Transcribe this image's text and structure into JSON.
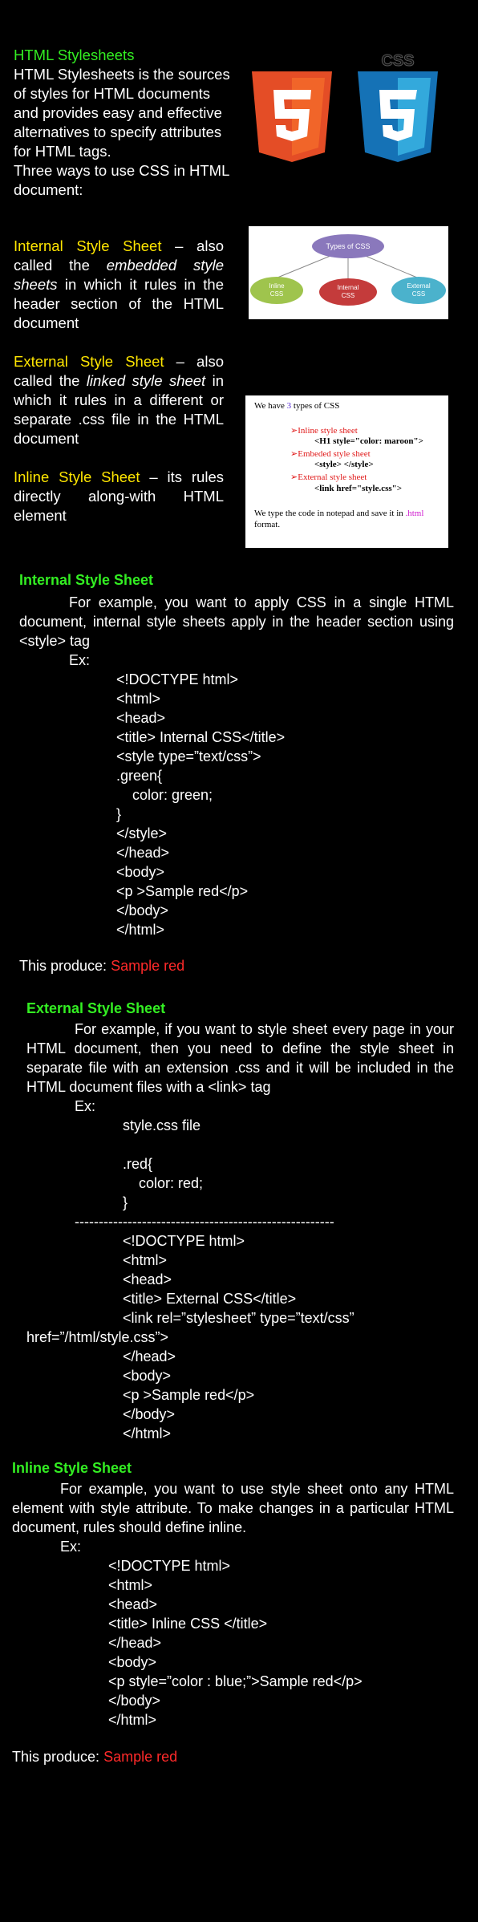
{
  "intro": {
    "heading": "HTML Stylesheets",
    "body": "HTML Stylesheets is the sources of styles for HTML documents and provides easy and effective alternatives to specify attributes for HTML tags.",
    "ways": "Three ways to use CSS in HTML document:"
  },
  "logos": {
    "html5": "5",
    "css3_label": "CSS",
    "css3": "3"
  },
  "types_diagram": {
    "root": "Types of CSS",
    "nodes": [
      "Inline CSS",
      "Internal CSS",
      "External CSS"
    ],
    "colors": {
      "root": "#8a78bc",
      "inline": "#9fc44d",
      "internal": "#c43b3b",
      "external": "#4bb2cc"
    }
  },
  "three_types": {
    "internal_label": "Internal Style Sheet",
    "internal_text_a": " – also called the ",
    "internal_em": "embedded style sheets",
    "internal_text_b": " in which it rules in the header section of the HTML document",
    "external_label": "External Style Sheet",
    "external_text_a": " – also called the ",
    "external_em": "linked style sheet",
    "external_text_b": " in which it rules in a different or separate .css file in the HTML document",
    "inline_label": "Inline Style Sheet",
    "inline_text": " – its rules directly along-with HTML element"
  },
  "note_box": {
    "we_have_a": "We have ",
    "we_have_num": "3",
    "we_have_b": " types of CSS",
    "arrow": "➢",
    "inline": "Inline style sheet",
    "inline_code": "<H1 style=\"color: maroon\">",
    "embeded": "Embeded style sheet",
    "embeded_code": "<style>   </style>",
    "external": "External style sheet",
    "external_code": "<link href=\"style.css\">",
    "notepad_a": "We type the code in notepad and save it in ",
    "notepad_ext": ".html",
    "notepad_b": "format."
  },
  "internal": {
    "heading": "Internal Style Sheet",
    "para": "For example, you want to apply CSS in a single HTML document, internal style sheets apply in the header section using <style> tag",
    "ex": "Ex:",
    "code": [
      "<!DOCTYPE html>",
      "<html>",
      "<head>",
      "<title> Internal CSS</title>",
      "<style type=”text/css”>",
      ".green{",
      "    color: green;",
      "}",
      "</style>",
      "</head>",
      "<body>",
      "<p >Sample red</p>",
      "</body>",
      "</html>"
    ],
    "produce": "This produce: ",
    "sample": "Sample red"
  },
  "external": {
    "heading": "External Style Sheet",
    "para": "For example, if you want to style sheet every page in your HTML document, then you need to define the style sheet in separate file with an extension .css and it will be included in the HTML document files with a <link> tag",
    "ex": "Ex:",
    "css_file": "style.css file",
    "css_code": [
      ".red{",
      "    color: red;",
      "}"
    ],
    "divider": "------------------------------------------------------",
    "code_a": [
      "<!DOCTYPE html>",
      "<html>",
      "<head>",
      "<title> External CSS</title>"
    ],
    "link_line_1": "<link          rel=”stylesheet”          type=”text/css”",
    "link_line_2": "href=”/html/style.css”>",
    "code_b": [
      "</head>",
      "<body>",
      "<p >Sample red</p>",
      "</body>",
      "</html>"
    ]
  },
  "inline": {
    "heading": "Inline Style Sheet",
    "para": "For example, you want to use style sheet onto any HTML element with style attribute. To make changes in a particular HTML document, rules should define inline.",
    "ex": "Ex:",
    "code": [
      "<!DOCTYPE html>",
      "<html>",
      "<head>",
      "<title> Inline CSS </title>",
      "</head>",
      "<body>",
      "<p style=”color : blue;”>Sample red</p>",
      "</body>",
      "</html>"
    ],
    "produce": "This produce: ",
    "sample": "Sample red"
  }
}
